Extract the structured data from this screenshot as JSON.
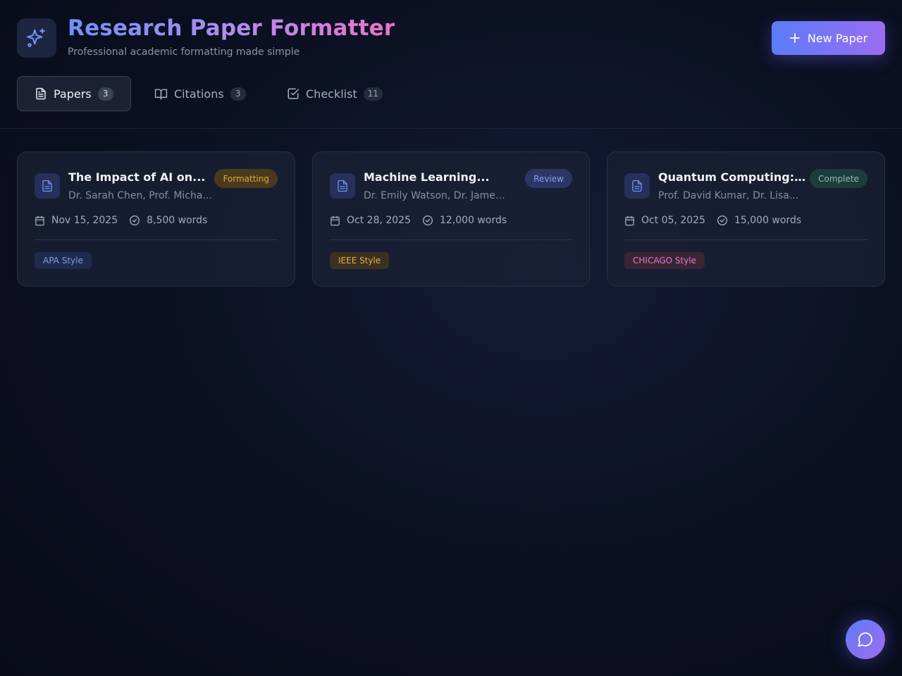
{
  "header": {
    "title": "Research Paper Formatter",
    "subtitle": "Professional academic formatting made simple",
    "new_button_label": "New Paper",
    "logo_icon": "sparkles-icon"
  },
  "tabs": [
    {
      "label": "Papers",
      "count": "3",
      "icon": "file-text-icon",
      "active": true
    },
    {
      "label": "Citations",
      "count": "3",
      "icon": "book-open-icon",
      "active": false
    },
    {
      "label": "Checklist",
      "count": "11",
      "icon": "check-square-icon",
      "active": false
    }
  ],
  "papers": [
    {
      "title": "The Impact of AI on...",
      "authors": "Dr. Sarah Chen, Prof. Micha...",
      "status": "Formatting",
      "date": "Nov 15, 2025",
      "words": "8,500 words",
      "style": "APA Style"
    },
    {
      "title": "Machine Learning...",
      "authors": "Dr. Emily Watson, Dr. James...",
      "status": "Review",
      "date": "Oct 28, 2025",
      "words": "12,000 words",
      "style": "IEEE Style"
    },
    {
      "title": "Quantum Computing:...",
      "authors": "Prof. David Kumar, Dr. Lisa...",
      "status": "Complete",
      "date": "Oct 05, 2025",
      "words": "15,000 words",
      "style": "CHICAGO Style"
    }
  ],
  "colors": {
    "accent": "#6e92f6",
    "status_formatting": "#e0a83a",
    "status_review": "#8c9df5",
    "status_complete": "#8fb9b0",
    "style_apa": "#7d9cf0",
    "style_ieee": "#e3b04a",
    "style_chicago": "#e07ac6"
  },
  "fab": {
    "icon": "chat-bubble-icon"
  }
}
